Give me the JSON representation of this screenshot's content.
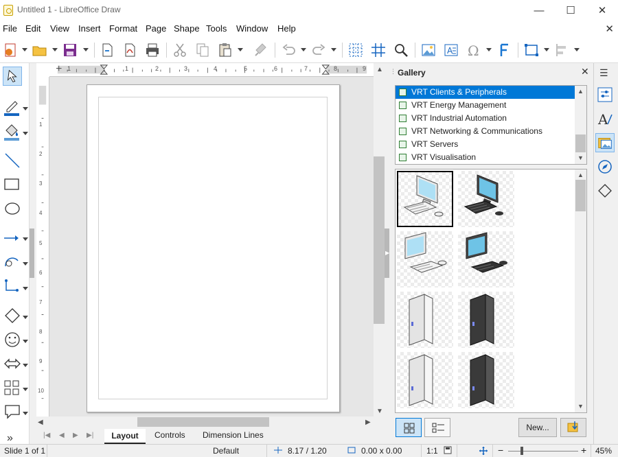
{
  "window": {
    "title": "Untitled 1 - LibreOffice Draw",
    "minimize": "—",
    "maximize": "☐",
    "close": "✕"
  },
  "menu": [
    "File",
    "Edit",
    "View",
    "Insert",
    "Format",
    "Page",
    "Shape",
    "Tools",
    "Window",
    "Help"
  ],
  "doc_close": "✕",
  "toolbar": {
    "overflow": "»"
  },
  "ruler": {
    "h_marks": [
      "1",
      "1",
      "2",
      "3",
      "4",
      "5",
      "6",
      "7",
      "8",
      "9"
    ],
    "v_marks": [
      "1",
      "2",
      "3",
      "4",
      "5",
      "6",
      "7",
      "8",
      "9",
      "10"
    ]
  },
  "tabs": [
    "Layout",
    "Controls",
    "Dimension Lines"
  ],
  "tab_nav": {
    "first": "⏮",
    "prev": "◀",
    "next": "▶",
    "last": "⏭",
    "more": "»"
  },
  "gallery": {
    "title": "Gallery",
    "close": "✕",
    "themes": [
      "VRT Clients & Peripherals",
      "VRT Energy Management",
      "VRT Industrial Automation",
      "VRT Networking & Communications",
      "VRT Servers",
      "VRT Visualisation"
    ],
    "selected_theme": 0,
    "items": [
      "Workstation (light)",
      "Workstation (dark)",
      "PC (light)",
      "PC (dark)",
      "Tower (light)",
      "Tower (dark)",
      "Tower 2 (light)",
      "Tower 2 (dark)"
    ],
    "new_button": "New..."
  },
  "status": {
    "slide": "Slide 1 of 1",
    "layout": "Default",
    "position": "8.17 / 1.20",
    "size": "0.00 x 0.00",
    "scale": "1:1",
    "zoom": "45%"
  },
  "colors": {
    "accent": "#0078d7",
    "selection": "#0078d7"
  }
}
